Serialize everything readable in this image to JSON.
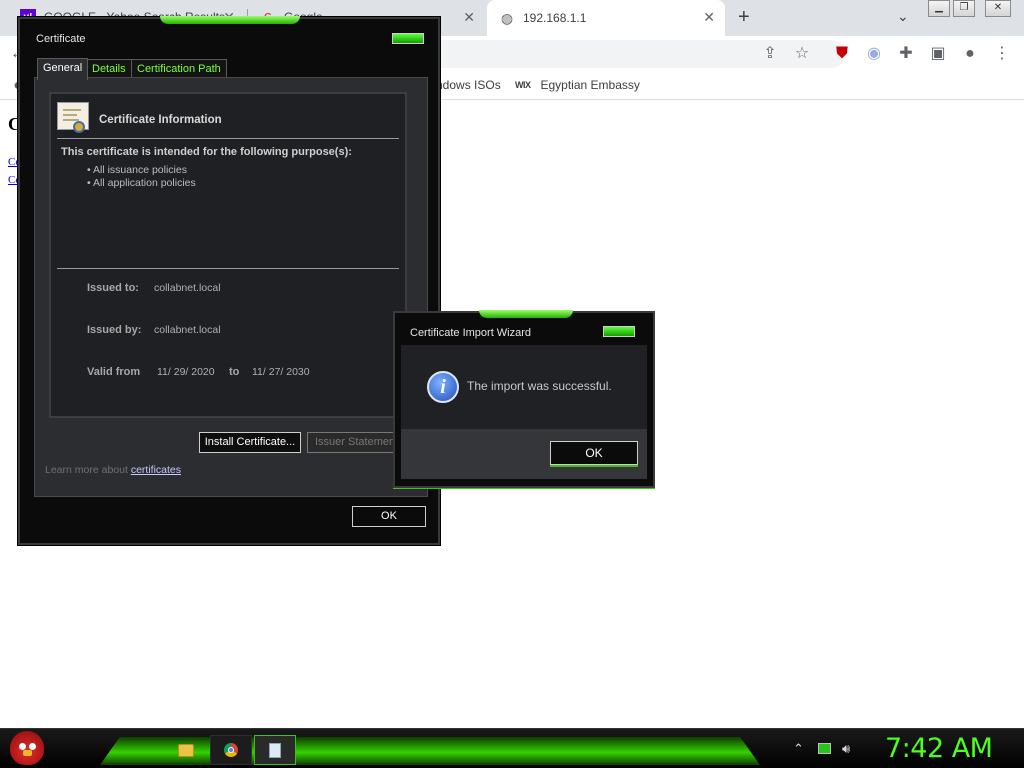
{
  "browser": {
    "tabs": [
      {
        "title": "GOOGLE - Yahoo Search Results",
        "favicon": "yahoo-icon"
      },
      {
        "title": "Google",
        "favicon": "google-icon"
      },
      {
        "title": "192.168.1.1",
        "favicon": "globe-icon"
      }
    ],
    "bookmarks": [
      {
        "label": "ndows ISOs"
      },
      {
        "label": "Egyptian Embassy",
        "icon_text": "WIX"
      }
    ],
    "page": {
      "heading": "C",
      "links": [
        "Ce",
        "Ce"
      ]
    }
  },
  "certificate_dialog": {
    "title": "Certificate",
    "tabs": [
      "General",
      "Details",
      "Certification Path"
    ],
    "info_title": "Certificate Information",
    "purpose_heading": "This certificate is intended for the following purpose(s):",
    "purposes": [
      "• All issuance policies",
      "• All application policies"
    ],
    "issued_to_label": "Issued to:",
    "issued_to": "collabnet.local",
    "issued_by_label": "Issued by:",
    "issued_by": "collabnet.local",
    "valid_from_label": "Valid from",
    "valid_from": "11/ 29/ 2020",
    "valid_to_label": "to",
    "valid_to": "11/ 27/ 2030",
    "install_button": "Install Certificate...",
    "issuer_button": "Issuer Statement",
    "learn_more_prefix": "Learn more about",
    "learn_more_link": "certificates",
    "ok_button": "OK"
  },
  "import_wizard": {
    "title": "Certificate Import Wizard",
    "message": "The import was successful.",
    "ok_button": "OK",
    "icon": "information-icon"
  },
  "taskbar": {
    "clock": "7:42 AM",
    "accent_color": "#4dff1f"
  }
}
